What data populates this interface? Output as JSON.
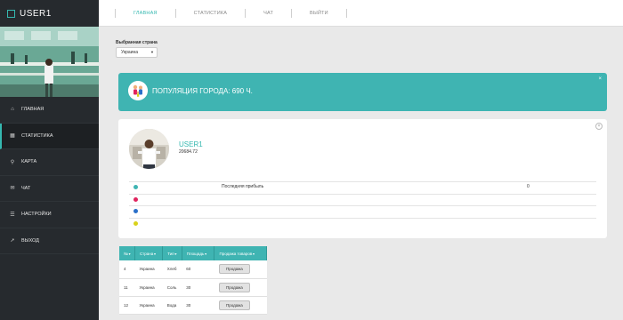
{
  "brand": {
    "title": "USER1"
  },
  "sidebar": {
    "items": [
      {
        "label": "ГЛАВНАЯ",
        "icon": "home-icon",
        "glyph": "⌂"
      },
      {
        "label": "СТАТИСТИКА",
        "icon": "calendar-icon",
        "glyph": "▦"
      },
      {
        "label": "КАРТА",
        "icon": "map-pin-icon",
        "glyph": "⚲"
      },
      {
        "label": "ЧАТ",
        "icon": "chat-icon",
        "glyph": "✉"
      },
      {
        "label": "НАСТРОЙКИ",
        "icon": "sliders-icon",
        "glyph": "☰"
      },
      {
        "label": "ВЫХОД",
        "icon": "rocket-icon",
        "glyph": "➚"
      }
    ],
    "active_index": 1
  },
  "topnav": {
    "items": [
      {
        "label": "ГЛАВНАЯ"
      },
      {
        "label": "СТАТИСТИКА"
      },
      {
        "label": "ЧАТ"
      },
      {
        "label": "ВЫЙТИ"
      }
    ],
    "active_index": 0
  },
  "country_select": {
    "label": "Выбранная страна",
    "value": "Украина"
  },
  "banner": {
    "text": "ПОПУЛЯЦИЯ ГОРОДА: 690 Ч.",
    "close": "×"
  },
  "profile": {
    "name": "USER1",
    "value": "20684.72",
    "close": "×",
    "rows": [
      {
        "color": "#3fb4b2",
        "label": "Последняя прибыль",
        "value": "0"
      },
      {
        "color": "#e0245e",
        "label": "",
        "value": ""
      },
      {
        "color": "#2a6fc9",
        "label": "",
        "value": ""
      },
      {
        "color": "#d9d21a",
        "label": "",
        "value": ""
      }
    ]
  },
  "table": {
    "headers": [
      "№",
      "Страна",
      "Тип",
      "Площадь",
      "Продажа товаров"
    ],
    "rows": [
      {
        "num": "4",
        "country": "Украина",
        "type": "Хлеб",
        "area": "60",
        "action": "Продажа"
      },
      {
        "num": "11",
        "country": "Украина",
        "type": "Соль",
        "area": "30",
        "action": "Продажа"
      },
      {
        "num": "12",
        "country": "Украина",
        "type": "Вода",
        "area": "30",
        "action": "Продажа"
      }
    ]
  },
  "colors": {
    "accent": "#3fb4b2",
    "sidebar": "#262a2e"
  }
}
